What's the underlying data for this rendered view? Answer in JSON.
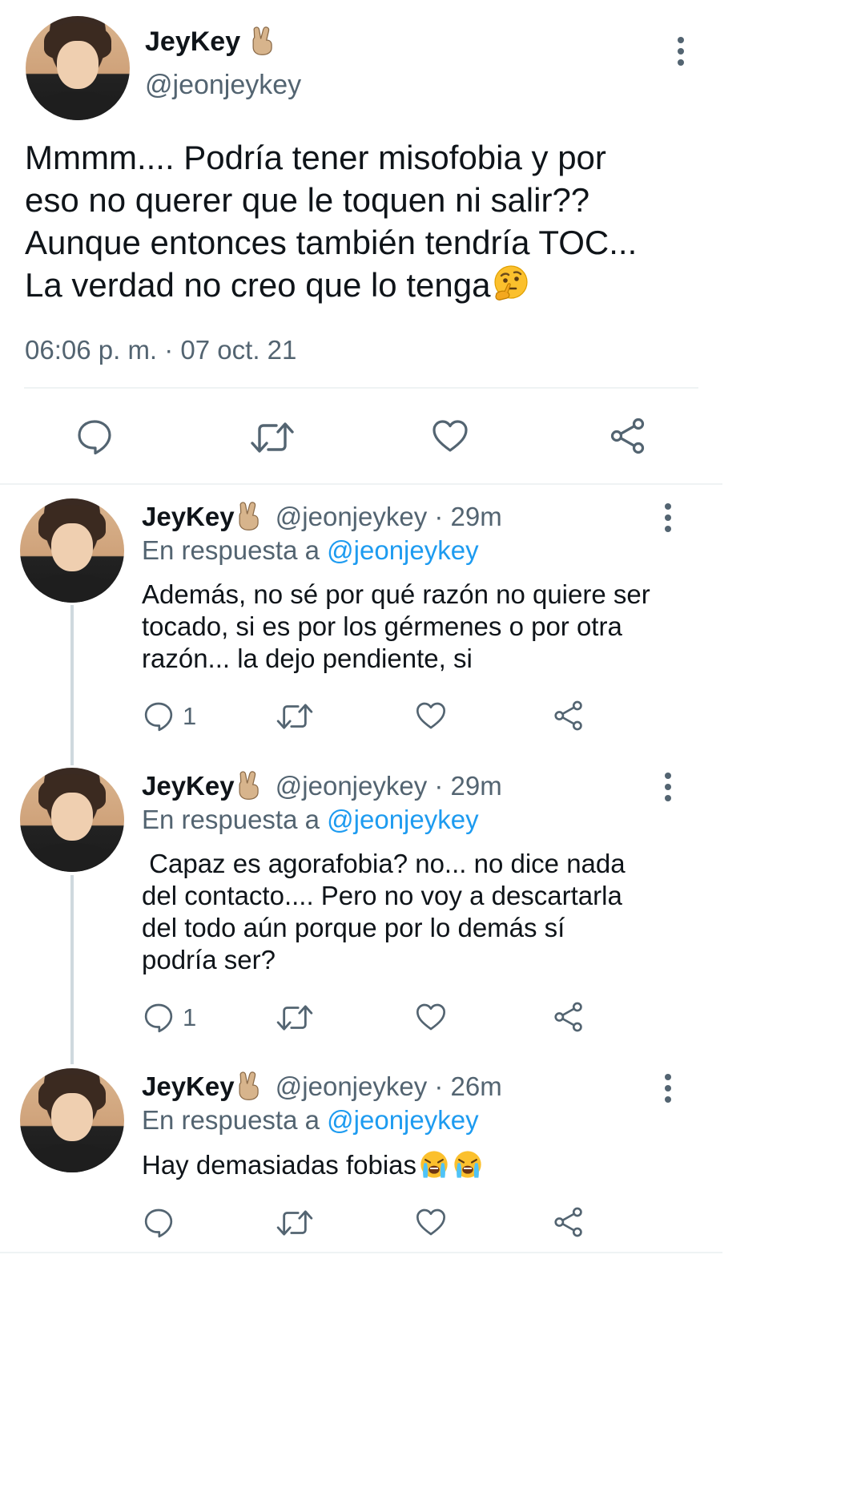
{
  "main_tweet": {
    "display_name": "JeyKey",
    "handle": "@jeonjeykey",
    "text_lines": [
      "Mmmm.... Podría tener misofobia y por",
      "eso no querer que le toquen ni salir??",
      "Aunque entonces también tendría TOC...",
      "La verdad no creo que lo tenga"
    ],
    "timestamp": "06:06 p. m. · 07 oct. 21"
  },
  "replies": [
    {
      "display_name": "JeyKey",
      "meta": "@jeonjeykey · 29m",
      "reply_prefix": "En respuesta a ",
      "reply_to": "@jeonjeykey",
      "text_lines": [
        "Además, no sé por qué razón no quiere ser",
        "tocado, si es por los gérmenes o por otra",
        "razón... la dejo pendiente, si"
      ],
      "reply_count": "1"
    },
    {
      "display_name": "JeyKey",
      "meta": "@jeonjeykey · 29m",
      "reply_prefix": "En respuesta a ",
      "reply_to": "@jeonjeykey",
      "text_lines": [
        " Capaz es agorafobia? no... no dice nada",
        "del contacto.... Pero no voy a descartarla",
        "del todo aún porque por lo demás sí",
        "podría ser?"
      ],
      "reply_count": "1"
    },
    {
      "display_name": "JeyKey",
      "meta": "@jeonjeykey · 26m",
      "reply_prefix": "En respuesta a ",
      "reply_to": "@jeonjeykey",
      "text_lines": [
        "Hay demasiadas fobias"
      ],
      "reply_count": ""
    }
  ],
  "icons": {
    "name_badge": "victory-hand-emoji",
    "thinking": "thinking-face-emoji",
    "crying": "loudly-crying-face-emoji",
    "reply": "reply-bubble-icon",
    "retweet": "retweet-icon",
    "like": "heart-icon",
    "share": "share-icon",
    "more": "more-vertical-icon"
  },
  "colors": {
    "link": "#1d9bf0",
    "muted": "#536471",
    "text": "#0f1419",
    "divider": "#eff3f4"
  }
}
